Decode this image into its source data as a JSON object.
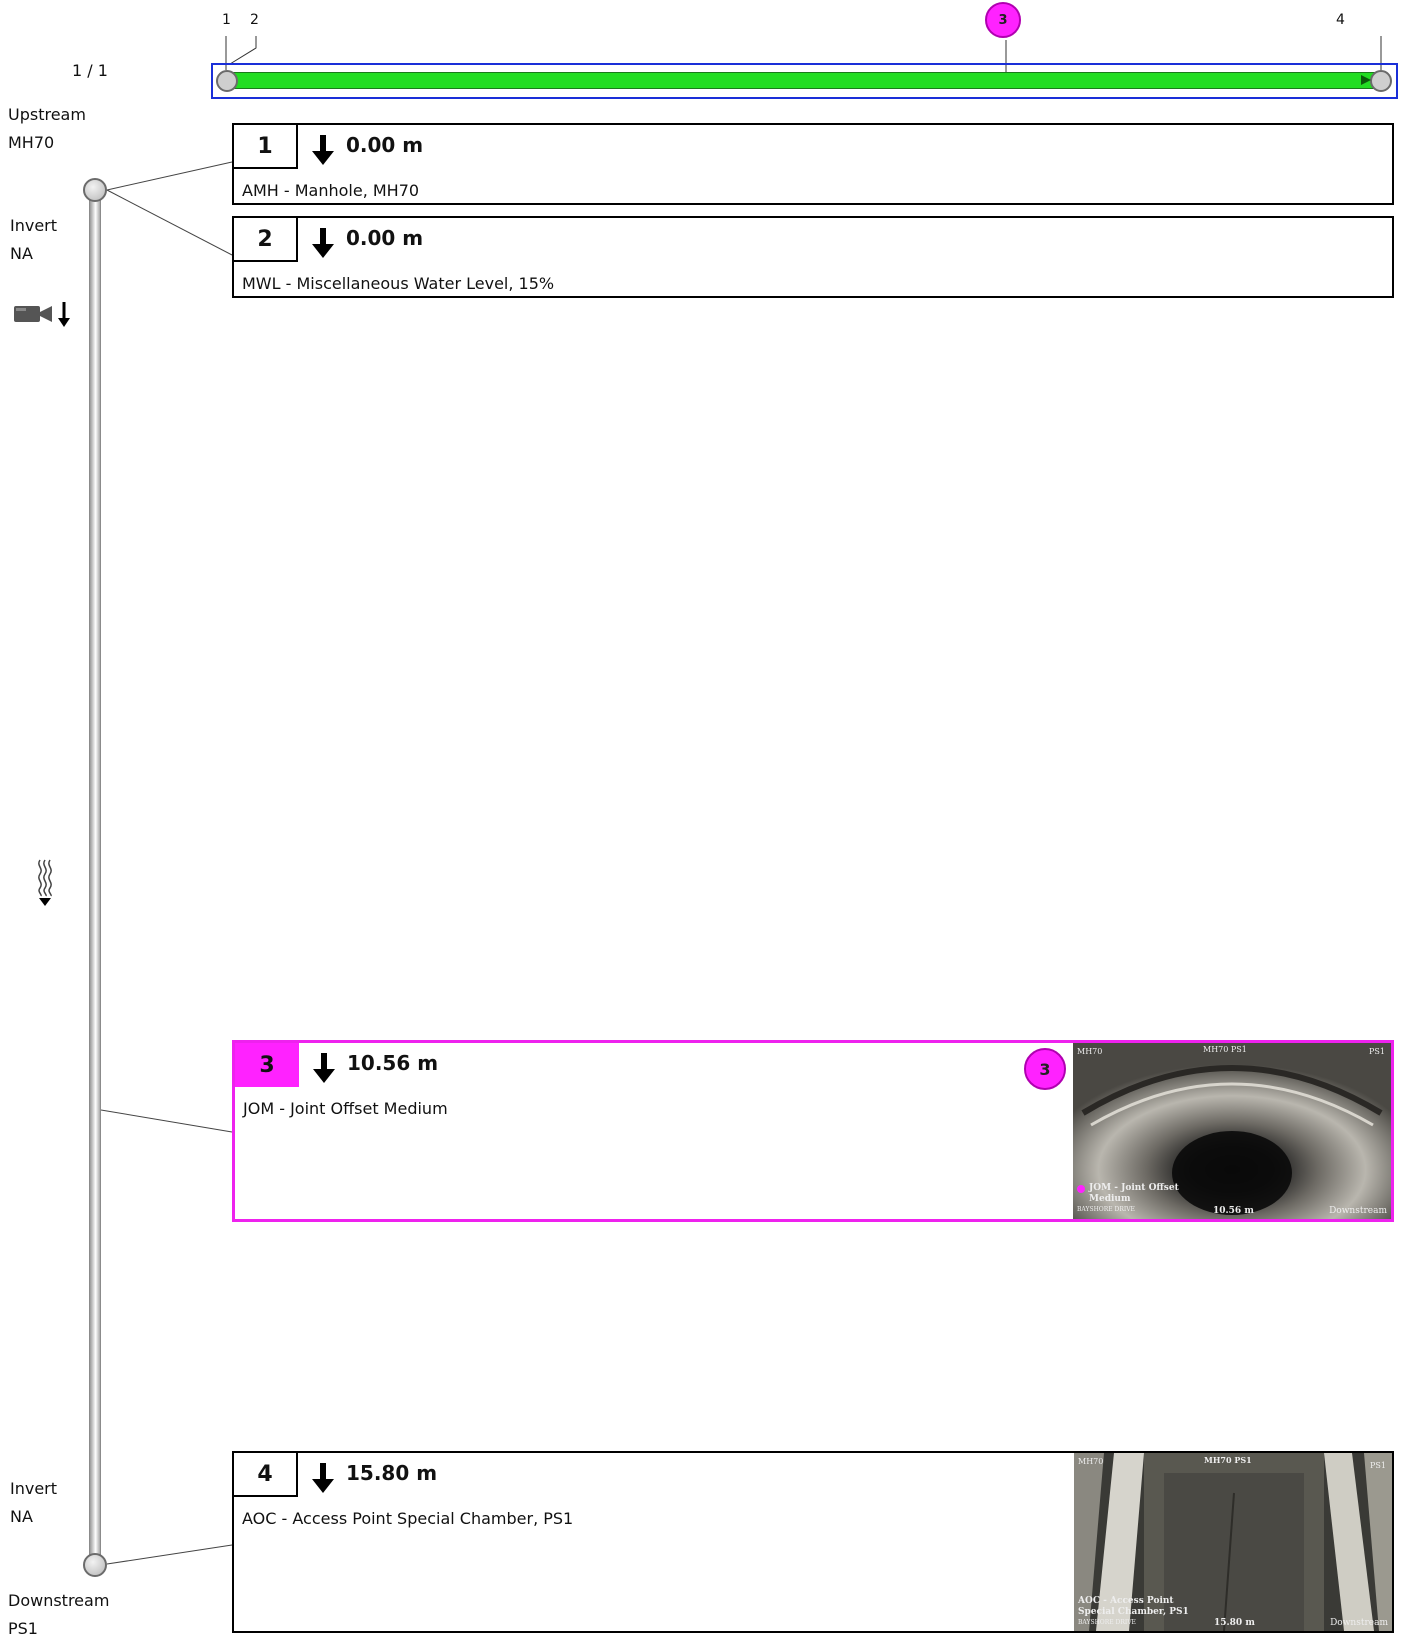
{
  "page_indicator": "1 / 1",
  "overview": {
    "markers": [
      {
        "label": "1"
      },
      {
        "label": "2"
      },
      {
        "label": "3"
      },
      {
        "label": "4"
      }
    ]
  },
  "upstream": {
    "label": "Upstream",
    "node": "MH70"
  },
  "invert_top": {
    "label": "Invert",
    "value": "NA"
  },
  "invert_bottom": {
    "label": "Invert",
    "value": "NA"
  },
  "downstream": {
    "label": "Downstream",
    "node": "PS1"
  },
  "observations": [
    {
      "number": "1",
      "distance": "0.00 m",
      "description": "AMH - Manhole, MH70"
    },
    {
      "number": "2",
      "distance": "0.00 m",
      "description": "MWL - Miscellaneous Water Level, 15%"
    },
    {
      "number": "3",
      "distance": "10.56 m",
      "description": "JOM - Joint Offset Medium",
      "badge": "3",
      "thumbnail": {
        "top_left": "MH70",
        "top_center": "MH70 PS1",
        "top_right": "PS1",
        "caption_line1": "JOM - Joint Offset",
        "caption_line2": "Medium",
        "street": "BAYSHORE DRIVE",
        "distance": "10.56 m",
        "direction": "Downstream"
      }
    },
    {
      "number": "4",
      "distance": "15.80 m",
      "description": "AOC - Access Point Special Chamber, PS1",
      "thumbnail": {
        "top_left": "MH70",
        "top_center": "MH70 PS1",
        "top_right": "PS1",
        "caption_line1": "AOC - Access Point",
        "caption_line2": "Special Chamber, PS1",
        "street": "BAYSHORE DRIVE",
        "distance": "15.80 m",
        "direction": "Downstream"
      }
    }
  ],
  "colors": {
    "highlight": "#ff22ff",
    "pipe_bar": "#22dd22",
    "frame": "#1a2fd8"
  },
  "icons": {
    "camera": "camera-icon",
    "camera_direction": "arrow-down-icon",
    "water_flow": "water-flow-icon"
  }
}
